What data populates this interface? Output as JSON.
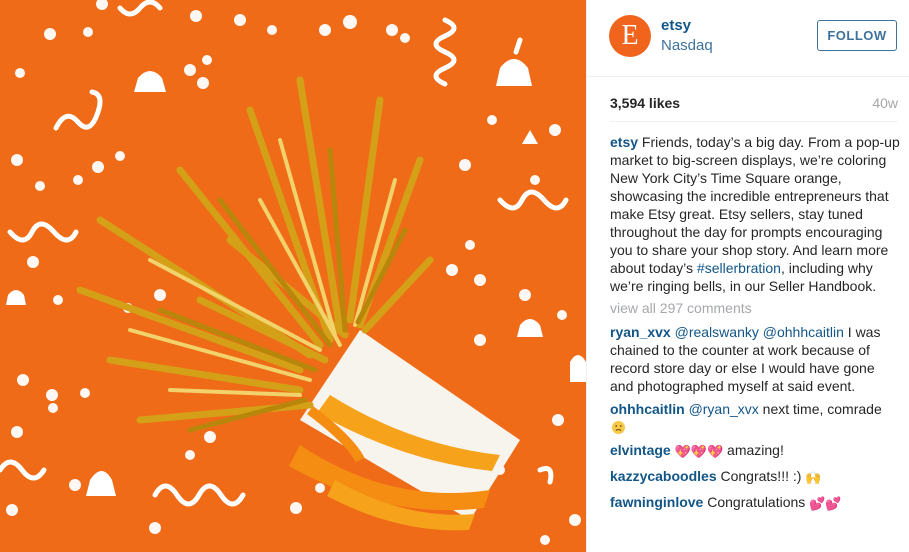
{
  "post": {
    "account": {
      "avatar_letter": "E",
      "username": "etsy",
      "location": "Nasdaq",
      "follow_label": "FOLLOW"
    },
    "likes": "3,594 likes",
    "age": "40w",
    "caption": {
      "username": "etsy",
      "text_before": " Friends, today’s a big day. From a pop-up market to big-screen displays, we’re coloring New York City’s Time Square orange, showcasing the incredible entrepreneurs that make Etsy great. Etsy sellers, stay tuned throughout the day for prompts encouraging you to share your shop story. And learn more about today’s ",
      "hashtag": "#sellerbration",
      "text_after": ", including why we’re ringing bells, in our Seller Handbook."
    },
    "view_all": "view all 297 comments",
    "comments": [
      {
        "username": "ryan_xvx",
        "mention1": "@realswanky",
        "mention2": "@ohhhcaitlin",
        "text": " I was chained to the counter at work because of record store day or else I would have gone and photographed myself at said event."
      },
      {
        "username": "ohhhcaitlin",
        "mention1": "@ryan_xvx",
        "text": " next time, comrade",
        "emoji": "disappointed-face"
      },
      {
        "username": "elvintage",
        "emoji": "💖💖💖",
        "text": " amazing!"
      },
      {
        "username": "kazzycaboodles",
        "text": " Congrats!!! :)",
        "emoji": "🙌"
      },
      {
        "username": "fawninginlove",
        "text": " Congratulations",
        "emoji": "💕💕"
      }
    ]
  },
  "image": {
    "description_colors": {
      "background": "#ef6b17",
      "confetti": "#ffffff",
      "tinsel": "#d4a017",
      "ribbon": "#f7a21b"
    }
  },
  "colors": {
    "link": "#125688",
    "secondary": "#3f729b",
    "muted": "#a5a7aa",
    "brand": "#f1641e"
  }
}
